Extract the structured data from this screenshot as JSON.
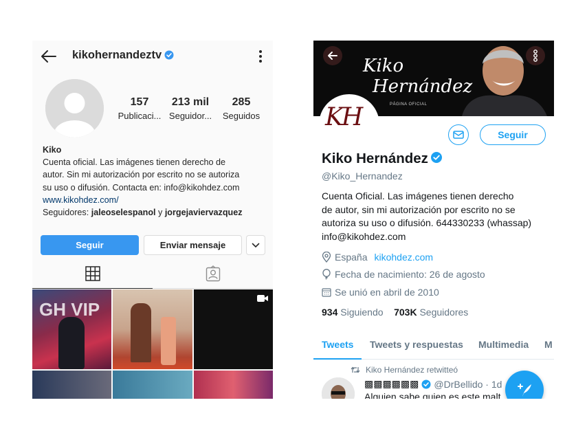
{
  "instagram": {
    "username": "kikohernandeztv",
    "stats": [
      {
        "num": "157",
        "label": "Publicaci..."
      },
      {
        "num": "213 mil",
        "label": "Seguidor..."
      },
      {
        "num": "285",
        "label": "Seguidos"
      }
    ],
    "bio": {
      "name": "Kiko",
      "line1": "Cuenta oficial. Las imágenes tienen derecho de",
      "line2": "autor. Sin mi autorización por escrito no se autoriza",
      "line3": "su uso o difusión. Contacta en: info@kikohdez.com",
      "website": "www.kikohdez.com/",
      "followers_prefix": "Seguidores:",
      "follower1": "jaleoselespanol",
      "connector": "y",
      "follower2": "jorgejaviervazquez"
    },
    "follow_label": "Seguir",
    "message_label": "Enviar mensaje",
    "grid_thumb_text": "GH VIP",
    "colors": {
      "accent": "#3897f0",
      "link": "#00376b",
      "verified": "#3897f0"
    }
  },
  "twitter": {
    "banner": {
      "name_line1": "Kiko",
      "name_line2": "Hernández",
      "subtitle": "PÁGINA OFICIAL"
    },
    "avatar_text": "KH",
    "follow_label": "Seguir",
    "name": "Kiko Hernández",
    "handle": "@Kiko_Hernandez",
    "bio_lines": [
      "Cuenta Oficial. Las imágenes tienen derecho",
      "de autor, sin mi autorización por escrito no se",
      "autoriza su uso o difusión. 644330233 (whassap)",
      "info@kikohdez.com"
    ],
    "location": "España",
    "website": "kikohdez.com",
    "birthday": "Fecha de nacimiento: 26 de agosto",
    "joined": "Se unió en abril de 2010",
    "following_count": "934",
    "following_label": "Siguiendo",
    "followers_count": "703K",
    "followers_label": "Seguidores",
    "tabs": [
      "Tweets",
      "Tweets y respuestas",
      "Multimedia",
      "M"
    ],
    "retweet_note": "Kiko Hernández retwitteó",
    "tweet": {
      "user": "▩▩▩▩▩▩",
      "handle": "@DrBellido",
      "sep": "·",
      "time": "1d",
      "text": "Alguien sabe quien es este malt"
    },
    "colors": {
      "accent": "#1da1f2",
      "text": "#14171a",
      "muted": "#657786"
    }
  }
}
